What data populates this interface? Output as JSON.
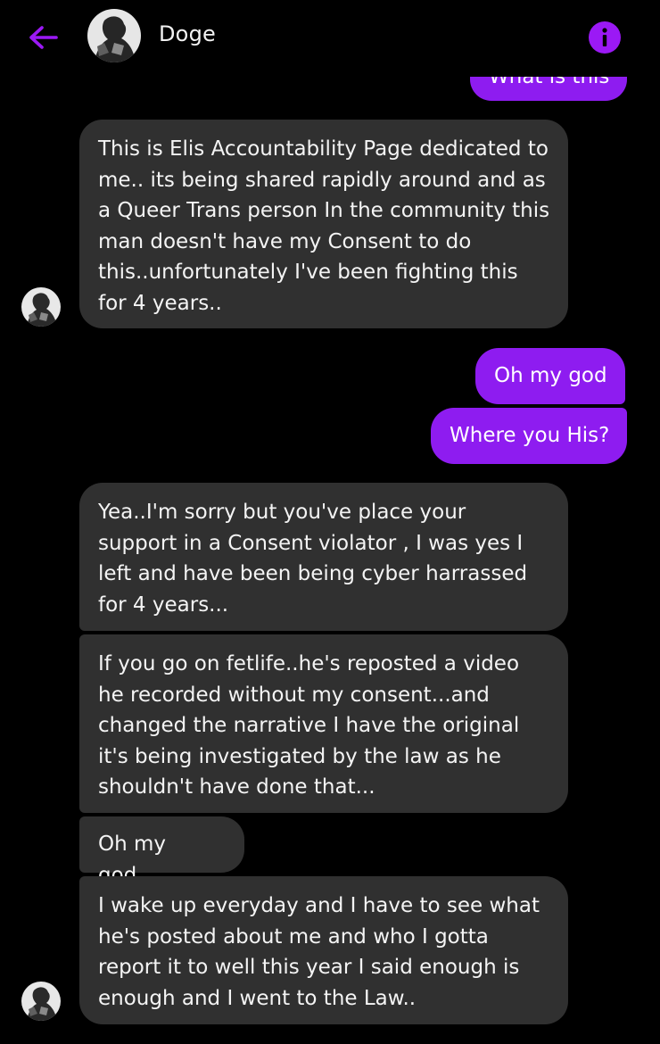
{
  "header": {
    "contact_name": "Doge",
    "accent_color": "#9b19f5",
    "back_icon": "arrow-left-icon",
    "info_icon": "info-icon"
  },
  "messages": [
    {
      "side": "out",
      "text": "What is this"
    },
    {
      "side": "in",
      "text": "This is Elis Accountability Page dedicated to me.. its being shared rapidly around and as a Queer Trans person In the community this man doesn't have my Consent to do this..unfortunately I've been fighting this for 4 years.."
    },
    {
      "side": "out",
      "text": "Oh my god"
    },
    {
      "side": "out",
      "text": "Where you His?"
    },
    {
      "side": "in",
      "text": "Yea..I'm sorry but you've place your support in a Consent violator , I was yes I left and have been being cyber harrassed for 4 years..."
    },
    {
      "side": "in",
      "text": "If you go on fetlife..he's reposted a video he recorded without my consent...and changed the narrative I have the original it's being investigated by the law as he shouldn't have done that..."
    },
    {
      "side": "in",
      "text": "Oh my god..."
    },
    {
      "side": "in",
      "text": "I wake up everyday and I have to see what he's posted about me and who I gotta report it to well this year I said enough is enough and I went to the Law.."
    }
  ]
}
